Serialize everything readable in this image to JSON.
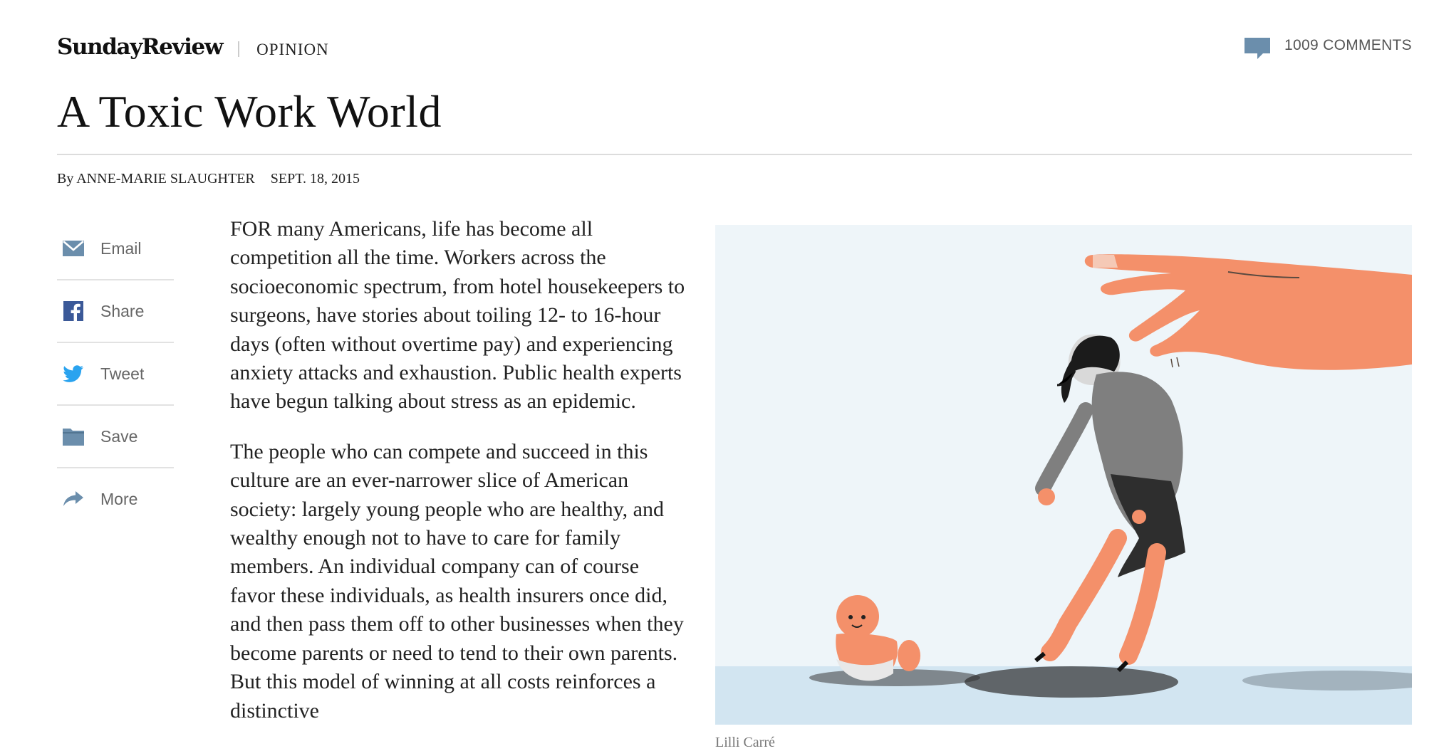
{
  "header": {
    "section": "SundayReview",
    "kicker": "OPINION",
    "comments_label": "1009 COMMENTS"
  },
  "article": {
    "headline": "A Toxic Work World",
    "byline_by": "By ANNE-MARIE SLAUGHTER",
    "date": "SEPT. 18, 2015",
    "paragraphs": [
      "FOR many Americans, life has become all competition all the time. Workers across the socioeconomic spectrum, from hotel housekeepers to surgeons, have stories about toiling 12- to 16-hour days (often without overtime pay) and experiencing anxiety attacks and exhaustion. Public health experts have begun talking about stress as an epidemic.",
      "The people who can compete and succeed in this culture are an ever-narrower slice of American society: largely young people who are healthy, and wealthy enough not to have to care for family members. An individual company can of course favor these individuals, as health insurers once did, and then pass them off to other businesses when they become parents or need to tend to their own parents. But this model of winning at all costs reinforces a distinctive"
    ],
    "image_credit": "Lilli Carré"
  },
  "share_tools": [
    {
      "label": "Email",
      "icon": "email-icon"
    },
    {
      "label": "Share",
      "icon": "facebook-icon"
    },
    {
      "label": "Tweet",
      "icon": "twitter-icon"
    },
    {
      "label": "Save",
      "icon": "folder-icon"
    },
    {
      "label": "More",
      "icon": "share-arrow-icon"
    }
  ],
  "colors": {
    "icon_blue": "#6b8eac",
    "facebook": "#3b5998",
    "twitter": "#2aa3ef",
    "illustration_bg": "#eef5f9",
    "illustration_floor": "#d2e5f1",
    "skin": "#f4906a"
  }
}
